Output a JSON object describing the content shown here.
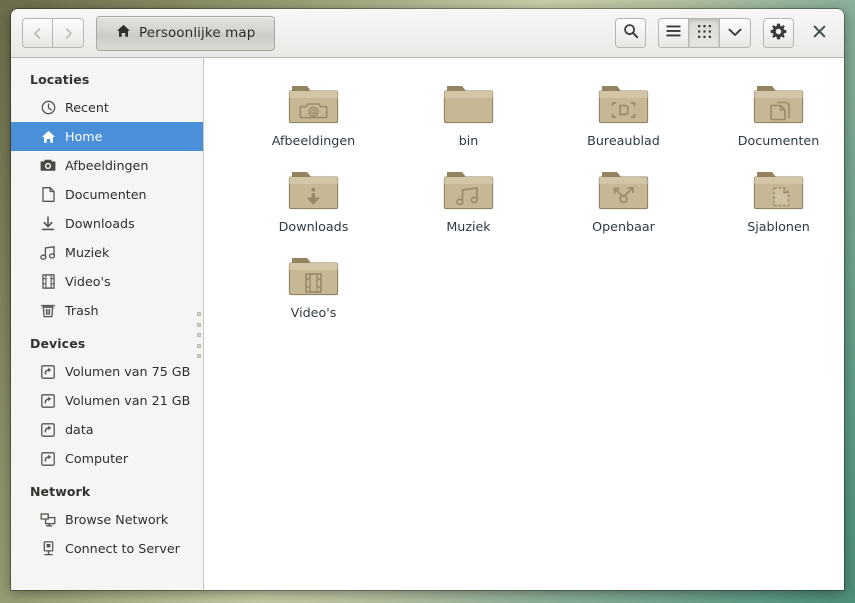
{
  "window": {
    "title": "Persoonlijke map",
    "accent_selection": "#4a90d9",
    "folder_color": "#c3b693"
  },
  "headerbar": {
    "nav": [
      {
        "name": "back-button",
        "glyph": "‹",
        "enabled": false
      },
      {
        "name": "forward-button",
        "glyph": "›",
        "enabled": false
      }
    ],
    "pathbar": {
      "icon": "home-icon",
      "label": "Persoonlijke map"
    },
    "search_label": "search-icon",
    "view_buttons": [
      {
        "name": "list-view-button",
        "icon": "list-icon",
        "active": false
      },
      {
        "name": "grid-view-button",
        "icon": "grid-icon",
        "active": true
      },
      {
        "name": "view-dropdown-button",
        "icon": "chevron-down-icon",
        "active": false
      }
    ],
    "gear_label": "gear-icon",
    "close_label": "close-icon"
  },
  "sidebar": {
    "sections": [
      {
        "heading": "Locaties",
        "items": [
          {
            "label": "Recent",
            "icon": "clock-icon",
            "selected": false
          },
          {
            "label": "Home",
            "icon": "home-icon",
            "selected": true
          },
          {
            "label": "Afbeeldingen",
            "icon": "camera-icon",
            "selected": false
          },
          {
            "label": "Documenten",
            "icon": "document-icon",
            "selected": false
          },
          {
            "label": "Downloads",
            "icon": "download-icon",
            "selected": false
          },
          {
            "label": "Muziek",
            "icon": "music-icon",
            "selected": false
          },
          {
            "label": "Video's",
            "icon": "film-icon",
            "selected": false
          },
          {
            "label": "Trash",
            "icon": "trash-icon",
            "selected": false
          }
        ]
      },
      {
        "heading": "Devices",
        "items": [
          {
            "label": "Volumen van 75 GB",
            "icon": "drive-icon",
            "selected": false
          },
          {
            "label": "Volumen van 21 GB",
            "icon": "drive-icon",
            "selected": false
          },
          {
            "label": "data",
            "icon": "drive-icon",
            "selected": false
          },
          {
            "label": "Computer",
            "icon": "drive-icon",
            "selected": false
          }
        ]
      },
      {
        "heading": "Network",
        "items": [
          {
            "label": "Browse Network",
            "icon": "network-icon",
            "selected": false
          },
          {
            "label": "Connect to Server",
            "icon": "server-icon",
            "selected": false
          }
        ]
      }
    ]
  },
  "files": [
    {
      "name": "Afbeeldingen",
      "emblem": "camera-emblem"
    },
    {
      "name": "bin",
      "emblem": "none"
    },
    {
      "name": "Bureaublad",
      "emblem": "desktop-emblem"
    },
    {
      "name": "Documenten",
      "emblem": "documents-emblem"
    },
    {
      "name": "Downloads",
      "emblem": "download-emblem"
    },
    {
      "name": "Muziek",
      "emblem": "music-emblem"
    },
    {
      "name": "Openbaar",
      "emblem": "share-emblem"
    },
    {
      "name": "Sjablonen",
      "emblem": "template-emblem"
    },
    {
      "name": "Video's",
      "emblem": "film-emblem"
    }
  ]
}
